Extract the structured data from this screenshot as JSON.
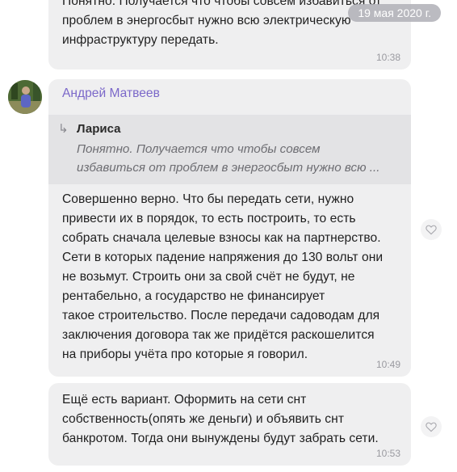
{
  "date_badge": "19 мая 2020 г.",
  "messages": [
    {
      "text": "Понятно. Получается что чтобы совсем избавиться от\nпроблем в энергосбыт нужно всю электрическую\nинфраструктуру передать.",
      "time": "10:38"
    },
    {
      "sender": "Андрей Матвеев",
      "reply": {
        "author": "Лариса",
        "text": "Понятно. Получается что чтобы совсем\nизбавиться от проблем в энергосбыт нужно всю ..."
      },
      "text": "Совершенно верно. Что бы передать сети, нужно\nпривести их  в порядок, то есть построить, то есть\nсобрать сначала  целевые взносы как на партнерство.\nСети в которых падение напряжения до 130 вольт они\nне возьмут. Строить они за свой счёт не будут, не\nрентабельно, а государство не финансирует\nтакое строительство. После передачи садоводам для\nзаключения договора так же придётся раскошелится\nна приборы учёта про которые я говорил.",
      "time": "10:49"
    },
    {
      "text": "Ещё есть вариант. Оформить на сети снт\nсобственность(опять же деньги) и объявить снт\nбанкротом. Тогда они вынуждены будут забрать сети.",
      "time": "10:53"
    }
  ],
  "icons": {
    "reply": "reply-arrow-icon",
    "like": "heart-icon"
  },
  "colors": {
    "bubble": "#efeff0",
    "quote": "#e3e3e5",
    "sender": "#7b68c9",
    "time": "#9a9aa0",
    "date_badge": "#afafb6"
  }
}
